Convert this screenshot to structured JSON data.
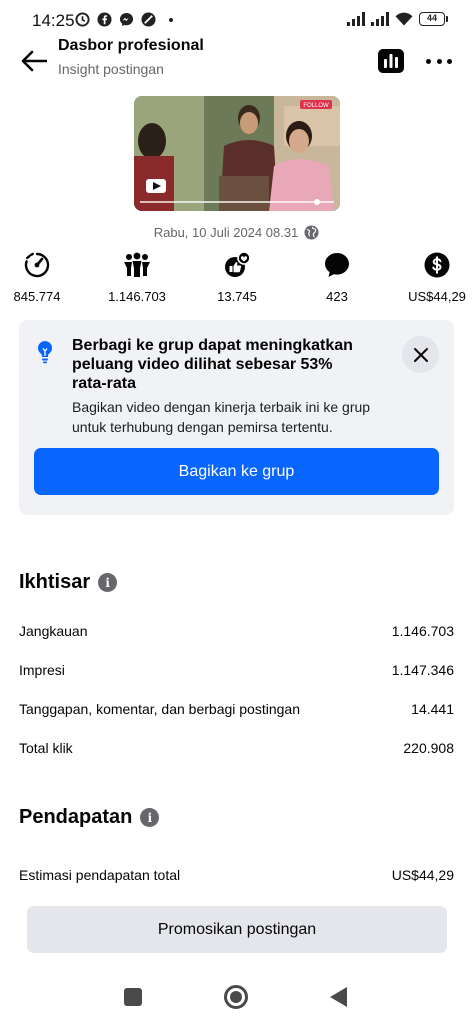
{
  "status_bar": {
    "time": "14:25",
    "battery": "44"
  },
  "header": {
    "title": "Dasbor profesional",
    "subtitle": "Insight postingan"
  },
  "post": {
    "timestamp": "Rabu, 10 Juli 2024 08.31",
    "thumbnail_badge": "FOLLOW"
  },
  "metrics": [
    {
      "icon": "plays-gauge-icon",
      "value": "845.774"
    },
    {
      "icon": "audience-people-icon",
      "value": "1.146.703"
    },
    {
      "icon": "reactions-icon",
      "value": "13.745"
    },
    {
      "icon": "comment-bubble-icon",
      "value": "423"
    },
    {
      "icon": "dollar-icon",
      "value": "US$44,29"
    }
  ],
  "tip": {
    "icon": "lightbulb-icon",
    "title": "Berbagi ke grup dapat meningkatkan peluang video dilihat sebesar 53% rata-rata",
    "body": "Bagikan video dengan kinerja terbaik ini ke grup untuk terhubung dengan pemirsa tertentu.",
    "button": "Bagikan ke grup"
  },
  "overview": {
    "title": "Ikhtisar",
    "rows": [
      {
        "label": "Jangkauan",
        "value": "1.146.703"
      },
      {
        "label": "Impresi",
        "value": "1.147.346"
      },
      {
        "label": "Tanggapan, komentar, dan berbagi postingan",
        "value": "14.441"
      },
      {
        "label": "Total klik",
        "value": "220.908"
      }
    ]
  },
  "earnings": {
    "title": "Pendapatan",
    "rows": [
      {
        "label": "Estimasi pendapatan total",
        "value": "US$44,29"
      }
    ]
  },
  "promote_button": "Promosikan postingan",
  "colors": {
    "accent": "#0866ff",
    "secondary_text": "#65676b",
    "card_bg": "#f0f2f5"
  }
}
